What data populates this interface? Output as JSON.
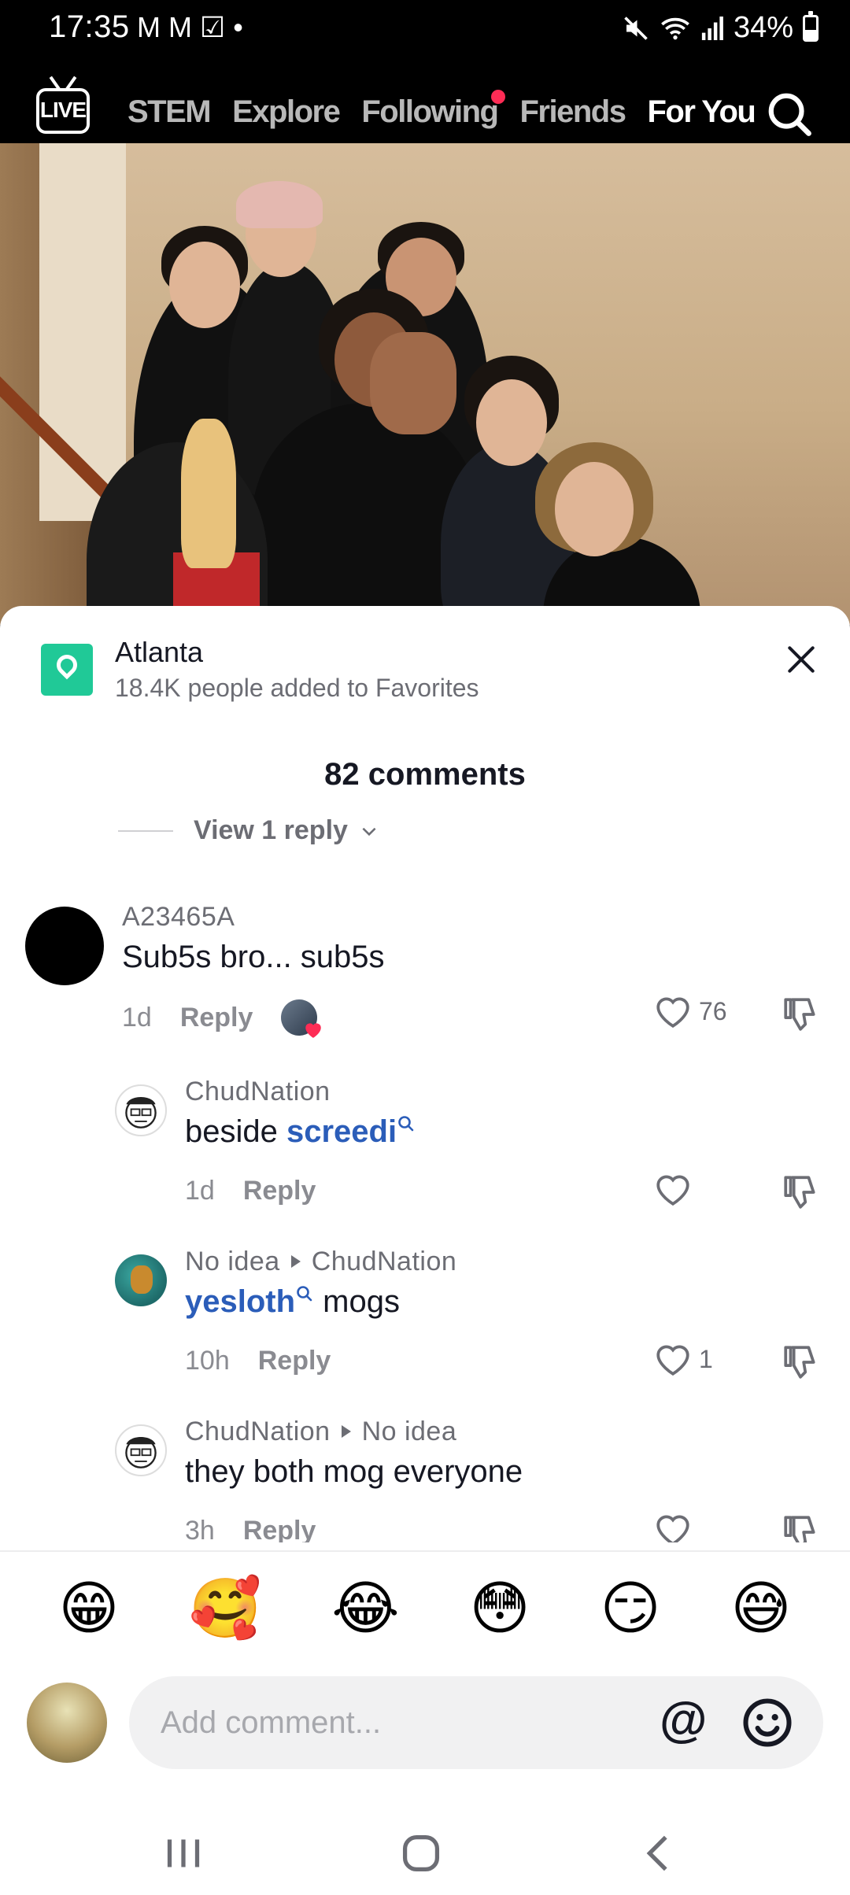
{
  "status_bar": {
    "time": "17:35",
    "notifications": [
      "M",
      "M",
      "☑",
      "•"
    ],
    "battery_percent": "34%",
    "battery_level": 0.34
  },
  "top_nav": {
    "live_label": "LIVE",
    "tabs": [
      {
        "label": "STEM"
      },
      {
        "label": "Explore"
      },
      {
        "label": "Following"
      },
      {
        "label": "Friends"
      },
      {
        "label": "For You"
      }
    ],
    "active_tab": "For You"
  },
  "sheet": {
    "location": {
      "title": "Atlanta",
      "subtitle": "18.4K people added to Favorites"
    },
    "comments_count": "82 comments",
    "view_reply": "View 1 reply",
    "comments": [
      {
        "username": "A23465A",
        "text": "Sub5s bro... sub5s",
        "time": "1d",
        "reply_label": "Reply",
        "likes": "76"
      },
      {
        "username": "ChudNation",
        "text_prefix": "beside ",
        "mention": "screedi",
        "time": "1d",
        "reply_label": "Reply",
        "likes": ""
      },
      {
        "username": "No idea",
        "reply_to": "ChudNation",
        "mention": "yesloth",
        "text_suffix": " mogs",
        "time": "10h",
        "reply_label": "Reply",
        "likes": "1"
      },
      {
        "username": "ChudNation",
        "reply_to": "No idea",
        "text": "they both mog everyone",
        "time": "3h",
        "reply_label": "Reply",
        "likes": ""
      }
    ]
  },
  "emoji_bar": [
    "😁",
    "🥰",
    "😂",
    "😳",
    "😏",
    "😅"
  ],
  "composer": {
    "placeholder": "Add comment...",
    "at_symbol": "@"
  },
  "colors": {
    "accent": "#fe2c55",
    "mention": "#2b5db9",
    "location_icon": "#20c997"
  }
}
